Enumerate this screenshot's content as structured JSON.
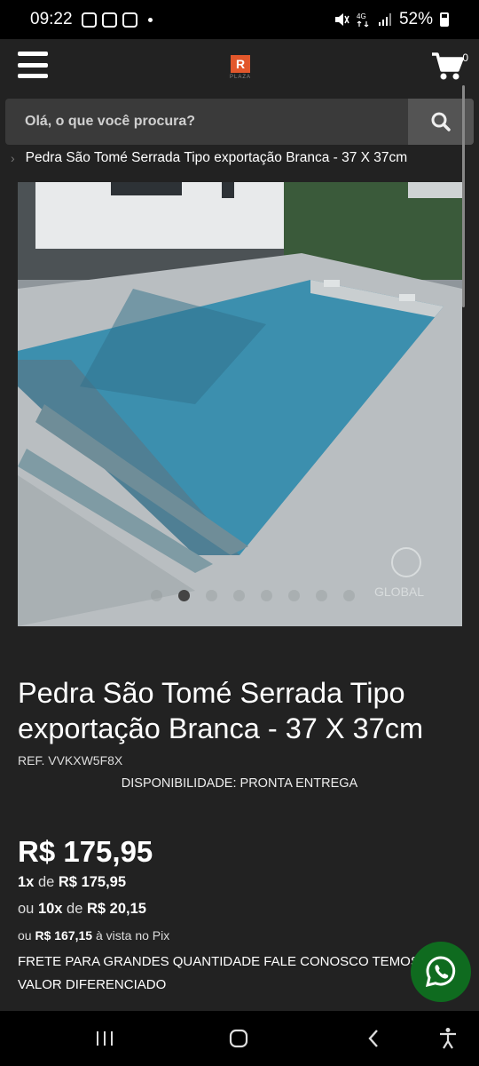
{
  "status_bar": {
    "time": "09:22",
    "battery": "52%"
  },
  "header": {
    "cart_count": "0",
    "logo_text": "PLAZA"
  },
  "search": {
    "placeholder": "Olá, o que você procura?"
  },
  "breadcrumb": {
    "current": "Pedra São Tomé Serrada Tipo exportação Branca - 37 X 37cm"
  },
  "gallery": {
    "watermark": "GLOBAL",
    "dot_count": 8,
    "active_dot": 1
  },
  "product": {
    "title": "Pedra São Tomé Serrada Tipo exportação Branca - 37 X 37cm",
    "ref": "REF. VVKXW5F8X",
    "availability": "DISPONIBILIDADE: PRONTA ENTREGA",
    "price": "R$ 175,95",
    "inst1_qty": "1x",
    "inst1_de": " de ",
    "inst1_value": "R$ 175,95",
    "inst2_prefix": "ou ",
    "inst2_qty": "10x",
    "inst2_de": " de ",
    "inst2_value": "R$ 20,15",
    "pix_prefix": "ou ",
    "pix_value": "R$ 167,15",
    "pix_suffix": " à vista no Pix",
    "frete": "FRETE PARA GRANDES QUANTIDADE FALE CONOSCO TEMOS VALOR DIFERENCIADO"
  },
  "colors": {
    "background": "#222222",
    "search_bg": "#3a3a3a",
    "whatsapp": "#0f6b1f",
    "logo": "#e2572b"
  }
}
